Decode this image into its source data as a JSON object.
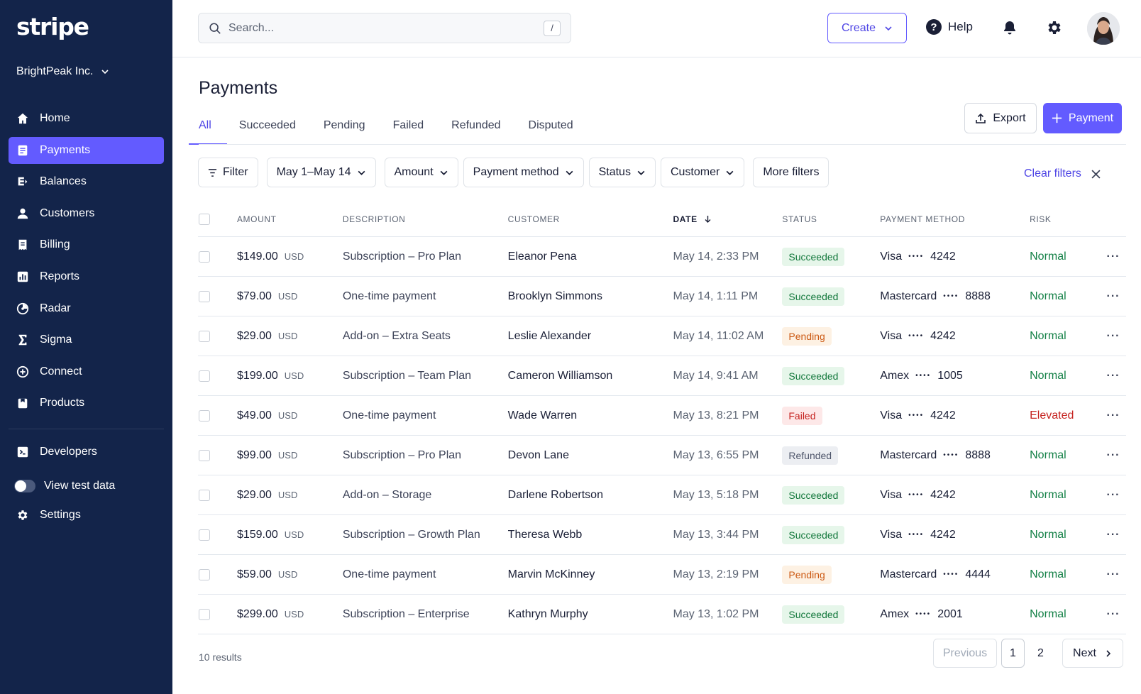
{
  "brand": {
    "logo_text": "stripe",
    "account_name": "BrightPeak Inc."
  },
  "colors": {
    "sidebar": "#13244a",
    "accent": "#635bff",
    "success": "#13783c",
    "pending": "#cc5a14",
    "failed": "#c5221f"
  },
  "sidebar": {
    "items": [
      {
        "label": "Home",
        "icon": "home-icon"
      },
      {
        "label": "Payments",
        "icon": "payments-icon",
        "active": true
      },
      {
        "label": "Balances",
        "icon": "balances-icon"
      },
      {
        "label": "Customers",
        "icon": "customers-icon"
      },
      {
        "label": "Billing",
        "icon": "billing-icon"
      },
      {
        "label": "Reports",
        "icon": "reports-icon"
      },
      {
        "label": "Radar",
        "icon": "radar-icon"
      },
      {
        "label": "Sigma",
        "icon": "sigma-icon"
      },
      {
        "label": "Connect",
        "icon": "connect-icon"
      },
      {
        "label": "Products",
        "icon": "products-icon"
      }
    ],
    "developers_label": "Developers",
    "test_data_label": "View test data",
    "settings_label": "Settings"
  },
  "topbar": {
    "search_placeholder": "Search...",
    "search_shortcut": "/",
    "create_label": "Create",
    "help_label": "Help",
    "help_glyph": "?"
  },
  "page": {
    "title": "Payments",
    "tabs": [
      "All",
      "Succeeded",
      "Pending",
      "Failed",
      "Refunded",
      "Disputed"
    ],
    "active_tab": "All",
    "export_label": "Export",
    "payment_label": "Payment"
  },
  "filters": {
    "filter_label": "Filter",
    "date_range": "May 1–May 14",
    "amount": "Amount",
    "payment_method": "Payment method",
    "status": "Status",
    "customer": "Customer",
    "more_filters": "More filters",
    "clear_filters": "Clear filters"
  },
  "table": {
    "headers": {
      "amount": "AMOUNT",
      "description": "DESCRIPTION",
      "customer": "CUSTOMER",
      "date": "DATE",
      "status": "STATUS",
      "payment_method": "PAYMENT METHOD",
      "risk": "RISK"
    },
    "rows": [
      {
        "amount": "$149.00",
        "currency": "USD",
        "description": "Subscription – Pro Plan",
        "customer": "Eleanor Pena",
        "date": "May 14, 2:33 PM",
        "status": "Succeeded",
        "card": "Visa",
        "dots": "••••",
        "last4": "4242",
        "risk": "Normal"
      },
      {
        "amount": "$79.00",
        "currency": "USD",
        "description": "One-time payment",
        "customer": "Brooklyn Simmons",
        "date": "May 14, 1:11 PM",
        "status": "Succeeded",
        "card": "Mastercard",
        "dots": "••••",
        "last4": "8888",
        "risk": "Normal"
      },
      {
        "amount": "$29.00",
        "currency": "USD",
        "description": "Add-on – Extra Seats",
        "customer": "Leslie Alexander",
        "date": "May 14, 11:02 AM",
        "status": "Pending",
        "card": "Visa",
        "dots": "••••",
        "last4": "4242",
        "risk": "Normal"
      },
      {
        "amount": "$199.00",
        "currency": "USD",
        "description": "Subscription – Team Plan",
        "customer": "Cameron Williamson",
        "date": "May 14, 9:41 AM",
        "status": "Succeeded",
        "card": "Amex",
        "dots": "••••",
        "last4": "1005",
        "risk": "Normal"
      },
      {
        "amount": "$49.00",
        "currency": "USD",
        "description": "One-time payment",
        "customer": "Wade Warren",
        "date": "May 13, 8:21 PM",
        "status": "Failed",
        "card": "Visa",
        "dots": "••••",
        "last4": "4242",
        "risk": "Elevated"
      },
      {
        "amount": "$99.00",
        "currency": "USD",
        "description": "Subscription – Pro Plan",
        "customer": "Devon Lane",
        "date": "May 13, 6:55 PM",
        "status": "Refunded",
        "card": "Mastercard",
        "dots": "••••",
        "last4": "8888",
        "risk": "Normal"
      },
      {
        "amount": "$29.00",
        "currency": "USD",
        "description": "Add-on – Storage",
        "customer": "Darlene Robertson",
        "date": "May 13, 5:18 PM",
        "status": "Succeeded",
        "card": "Visa",
        "dots": "••••",
        "last4": "4242",
        "risk": "Normal"
      },
      {
        "amount": "$159.00",
        "currency": "USD",
        "description": "Subscription – Growth Plan",
        "customer": "Theresa Webb",
        "date": "May 13, 3:44 PM",
        "status": "Succeeded",
        "card": "Visa",
        "dots": "••••",
        "last4": "4242",
        "risk": "Normal"
      },
      {
        "amount": "$59.00",
        "currency": "USD",
        "description": "One-time payment",
        "customer": "Marvin McKinney",
        "date": "May 13, 2:19 PM",
        "status": "Pending",
        "card": "Mastercard",
        "dots": "••••",
        "last4": "4444",
        "risk": "Normal"
      },
      {
        "amount": "$299.00",
        "currency": "USD",
        "description": "Subscription – Enterprise",
        "customer": "Kathryn Murphy",
        "date": "May 13, 1:02 PM",
        "status": "Succeeded",
        "card": "Amex",
        "dots": "••••",
        "last4": "2001",
        "risk": "Normal"
      }
    ],
    "more_glyph": "···"
  },
  "footer": {
    "results_text": "10 results",
    "previous_label": "Previous",
    "pages": [
      "1",
      "2"
    ],
    "current_page": "1",
    "next_label": "Next"
  }
}
